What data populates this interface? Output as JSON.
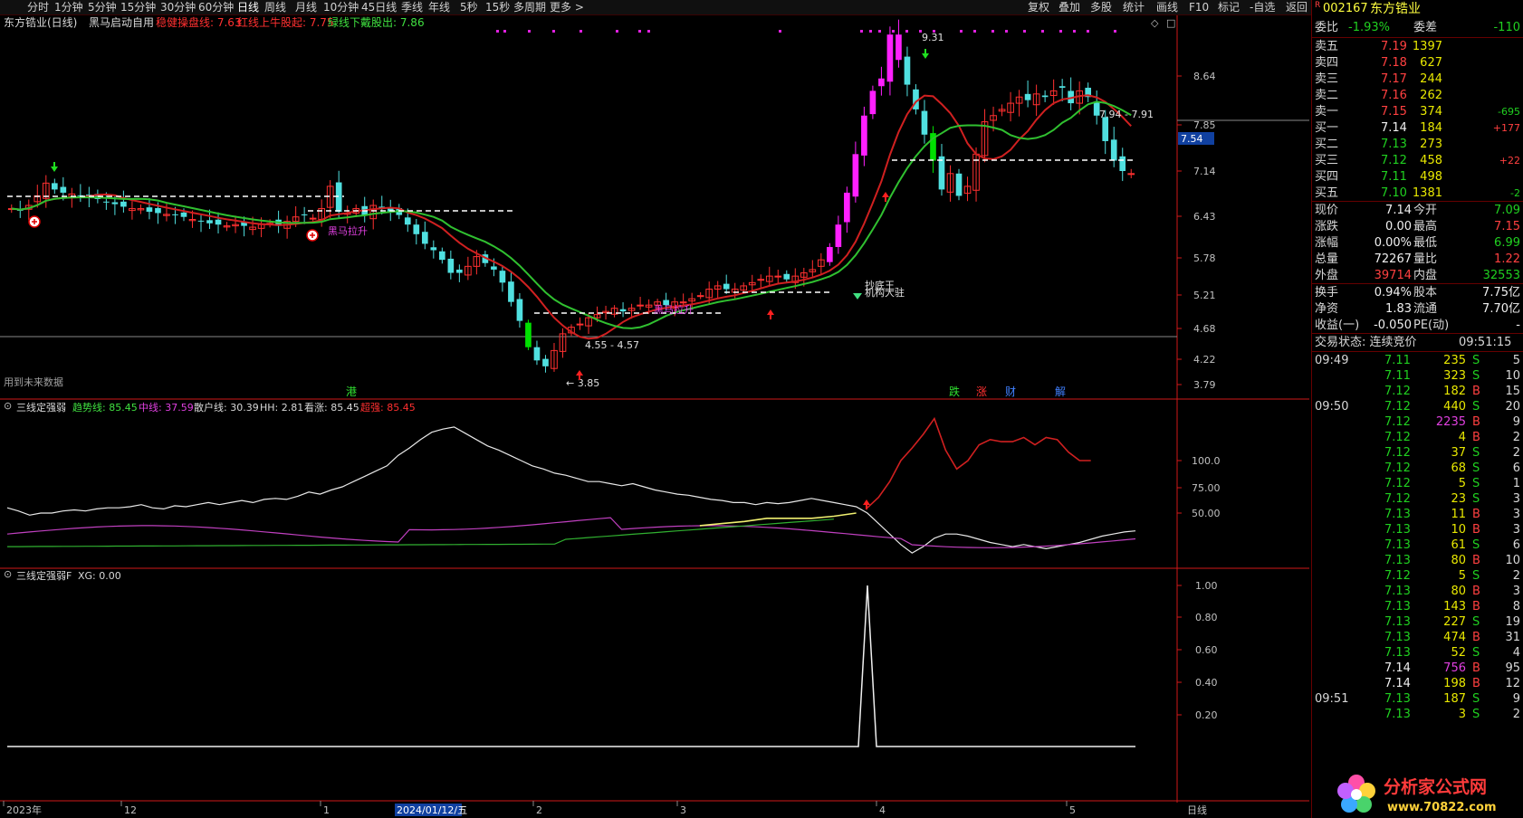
{
  "toolbar": {
    "periods": [
      "分时",
      "1分钟",
      "5分钟",
      "15分钟",
      "30分钟",
      "60分钟",
      "日线",
      "周线",
      "月线",
      "10分钟",
      "45日线",
      "季线",
      "年线",
      "5秒",
      "15秒",
      "多周期",
      "更多 >"
    ],
    "right": [
      "复权",
      "叠加",
      "多股",
      "统计",
      "画线",
      "F10",
      "标记",
      "-自选",
      "返回"
    ]
  },
  "main_chart": {
    "header": {
      "title": "东方锆业(日线)",
      "indicator": "黑马启动自用",
      "line1": "稳健操盘线: 7.63",
      "line2": "红线上牛股起: 7.75",
      "line3": "绿线下戴股出: 7.86"
    },
    "price_ticks": [
      "8.64",
      "7.85",
      "7.14",
      "6.43",
      "5.78",
      "5.21",
      "4.68",
      "4.22",
      "3.79"
    ],
    "current_price_tag": "7.54",
    "annotations": {
      "high": "9.31",
      "range1": "7.94 - 7.91",
      "range2": "4.55 - 4.57",
      "low": "3.85",
      "signal1": "黑马拉升",
      "signal2": "黑马拉升",
      "signal3": "机构大驻",
      "signal4": "抄底王",
      "future_note": "用到未来数据",
      "markers": [
        "港",
        "跌",
        "涨",
        "财",
        "解"
      ]
    }
  },
  "indicator1": {
    "name": "三线定强弱",
    "trend": "趋势线: 85.45",
    "mid": "中线: 37.59",
    "retail": "散户线: 30.39",
    "hh": "HH: 2.81",
    "rise": "看涨: 85.45",
    "strong": "超强: 85.45",
    "ticks": [
      "100.0",
      "75.00",
      "50.00"
    ]
  },
  "indicator2": {
    "name": "三线定强弱F",
    "xg": "XG: 0.00",
    "ticks": [
      "1.00",
      "0.80",
      "0.60",
      "0.40",
      "0.20"
    ]
  },
  "x_axis": {
    "labels": [
      "2023年",
      "12",
      "1",
      "2024/01/12/五",
      "2",
      "3",
      "4",
      "5"
    ],
    "period": "日线"
  },
  "quote": {
    "code": "002167",
    "name": "东方锆业",
    "webi_label": "委比",
    "webi": "-1.93%",
    "wecha_label": "委差",
    "wecha": "-110",
    "asks": [
      {
        "label": "卖五",
        "price": "7.19",
        "vol": "1397",
        "chg": ""
      },
      {
        "label": "卖四",
        "price": "7.18",
        "vol": "627",
        "chg": ""
      },
      {
        "label": "卖三",
        "price": "7.17",
        "vol": "244",
        "chg": ""
      },
      {
        "label": "卖二",
        "price": "7.16",
        "vol": "262",
        "chg": ""
      },
      {
        "label": "卖一",
        "price": "7.15",
        "vol": "374",
        "chg": "-695"
      }
    ],
    "bids": [
      {
        "label": "买一",
        "price": "7.14",
        "vol": "184",
        "chg": "+177"
      },
      {
        "label": "买二",
        "price": "7.13",
        "vol": "273",
        "chg": ""
      },
      {
        "label": "买三",
        "price": "7.12",
        "vol": "458",
        "chg": "+22"
      },
      {
        "label": "买四",
        "price": "7.11",
        "vol": "498",
        "chg": ""
      },
      {
        "label": "买五",
        "price": "7.10",
        "vol": "1381",
        "chg": "-2"
      }
    ],
    "stats": [
      {
        "l1": "现价",
        "v1": "7.14",
        "l2": "今开",
        "v2": "7.09",
        "c1": "w",
        "c2": "g"
      },
      {
        "l1": "涨跌",
        "v1": "0.00",
        "l2": "最高",
        "v2": "7.15",
        "c1": "w",
        "c2": "r"
      },
      {
        "l1": "涨幅",
        "v1": "0.00%",
        "l2": "最低",
        "v2": "6.99",
        "c1": "w",
        "c2": "g"
      },
      {
        "l1": "总量",
        "v1": "72267",
        "l2": "量比",
        "v2": "1.22",
        "c1": "w",
        "c2": "r"
      },
      {
        "l1": "外盘",
        "v1": "39714",
        "l2": "内盘",
        "v2": "32553",
        "c1": "r",
        "c2": "g"
      }
    ],
    "stats2": [
      {
        "l1": "换手",
        "v1": "0.94%",
        "l2": "股本",
        "v2": "7.75亿"
      },
      {
        "l1": "净资",
        "v1": "1.83",
        "l2": "流通",
        "v2": "7.70亿"
      },
      {
        "l1": "收益(一)",
        "v1": "-0.050",
        "l2": "PE(动)",
        "v2": "-"
      }
    ],
    "status": "交易状态: 连续竞价",
    "status_time": "09:51:15",
    "ticks": [
      {
        "t": "09:49",
        "p": "7.11",
        "v": "235",
        "bs": "S",
        "n": "5"
      },
      {
        "t": "",
        "p": "7.11",
        "v": "323",
        "bs": "S",
        "n": "10"
      },
      {
        "t": "",
        "p": "7.12",
        "v": "182",
        "bs": "B",
        "n": "15"
      },
      {
        "t": "09:50",
        "p": "7.12",
        "v": "440",
        "bs": "S",
        "n": "20"
      },
      {
        "t": "",
        "p": "7.12",
        "v": "2235",
        "bs": "B",
        "n": "9"
      },
      {
        "t": "",
        "p": "7.12",
        "v": "4",
        "bs": "B",
        "n": "2"
      },
      {
        "t": "",
        "p": "7.12",
        "v": "37",
        "bs": "S",
        "n": "2"
      },
      {
        "t": "",
        "p": "7.12",
        "v": "68",
        "bs": "S",
        "n": "6"
      },
      {
        "t": "",
        "p": "7.12",
        "v": "5",
        "bs": "S",
        "n": "1"
      },
      {
        "t": "",
        "p": "7.12",
        "v": "23",
        "bs": "S",
        "n": "3"
      },
      {
        "t": "",
        "p": "7.13",
        "v": "11",
        "bs": "B",
        "n": "3"
      },
      {
        "t": "",
        "p": "7.13",
        "v": "10",
        "bs": "B",
        "n": "3"
      },
      {
        "t": "",
        "p": "7.13",
        "v": "61",
        "bs": "S",
        "n": "6"
      },
      {
        "t": "",
        "p": "7.13",
        "v": "80",
        "bs": "B",
        "n": "10"
      },
      {
        "t": "",
        "p": "7.12",
        "v": "5",
        "bs": "S",
        "n": "2"
      },
      {
        "t": "",
        "p": "7.13",
        "v": "80",
        "bs": "B",
        "n": "3"
      },
      {
        "t": "",
        "p": "7.13",
        "v": "143",
        "bs": "B",
        "n": "8"
      },
      {
        "t": "",
        "p": "7.13",
        "v": "227",
        "bs": "S",
        "n": "19"
      },
      {
        "t": "",
        "p": "7.13",
        "v": "474",
        "bs": "B",
        "n": "31"
      },
      {
        "t": "",
        "p": "7.13",
        "v": "52",
        "bs": "S",
        "n": "4"
      },
      {
        "t": "",
        "p": "7.14",
        "v": "756",
        "bs": "B",
        "n": "95"
      },
      {
        "t": "",
        "p": "7.14",
        "v": "198",
        "bs": "B",
        "n": "12"
      },
      {
        "t": "09:51",
        "p": "7.13",
        "v": "187",
        "bs": "S",
        "n": "9"
      },
      {
        "t": "",
        "p": "7.13",
        "v": "3",
        "bs": "S",
        "n": "2"
      }
    ]
  },
  "watermark": {
    "title": "分析家公式网",
    "url": "www.70822.com"
  }
}
